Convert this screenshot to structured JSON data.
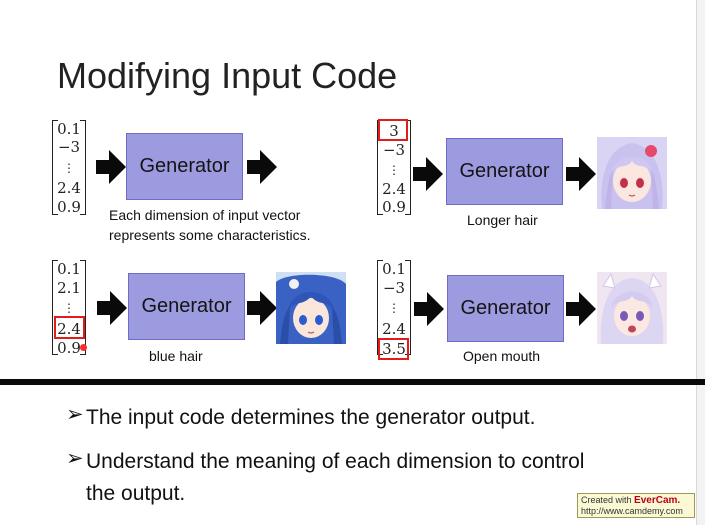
{
  "slide": {
    "title": "Modifying Input Code",
    "panels": {
      "tl": {
        "vector": [
          "0.1",
          "−3",
          "⋮",
          "2.4",
          "0.9"
        ],
        "generator": "Generator",
        "caption_lines": [
          "Each dimension of input vector",
          "represents some characteristics."
        ]
      },
      "tr": {
        "vector": [
          "3",
          "−3",
          "⋮",
          "2.4",
          "0.9"
        ],
        "highlight_index": 0,
        "generator": "Generator",
        "caption": "Longer hair",
        "image": "anime-girl-long-white-hair"
      },
      "bl": {
        "vector": [
          "0.1",
          "2.1",
          "⋮",
          "2.4",
          "0.9"
        ],
        "highlight_index": 3,
        "generator": "Generator",
        "caption": "blue hair",
        "image": "anime-girl-blue-hair"
      },
      "br": {
        "vector": [
          "0.1",
          "−3",
          "⋮",
          "2.4",
          "3.5"
        ],
        "highlight_index": 4,
        "generator": "Generator",
        "caption": "Open mouth",
        "image": "anime-girl-open-mouth"
      }
    },
    "bullets": [
      {
        "mark": "➢",
        "text": "The input code determines the generator output."
      },
      {
        "mark": "➢",
        "text": "Understand the meaning of each dimension to control the output."
      }
    ]
  },
  "credit": {
    "prefix": "Created with",
    "brand": "EverCam.",
    "url": "http://www.camdemy.com"
  },
  "colors": {
    "generator_fill": "#9d9be0",
    "highlight": "#e31b1b",
    "blue_hair": "#3a62c4",
    "white_hair": "#d9d4f4"
  },
  "icons": {
    "arrow": "arrow-right-icon",
    "bullet": "arrow-bullet-icon"
  }
}
